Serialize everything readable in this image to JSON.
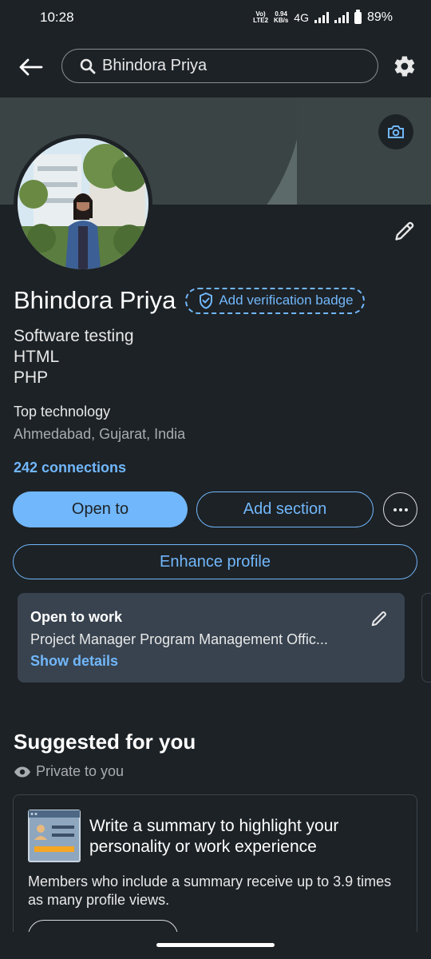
{
  "status_bar": {
    "time": "10:28",
    "volte": "Vo)) LTE2",
    "speed": "0.94 KB/s",
    "network": "4G",
    "battery": "89%"
  },
  "header": {
    "search_value": "Bhindora Priya",
    "icons": [
      "back-arrow-icon",
      "search-icon",
      "gear-icon",
      "camera-icon",
      "pencil-icon"
    ]
  },
  "profile": {
    "name": "Bhindora Priya",
    "verification_label": "Add verification badge",
    "headline": [
      "Software testing",
      "HTML",
      "PHP"
    ],
    "company": "Top technology",
    "location": "Ahmedabad, Gujarat, India",
    "connections": "242 connections"
  },
  "actions": {
    "open_to": "Open to",
    "add_section": "Add section",
    "enhance_profile": "Enhance profile"
  },
  "open_to_work": {
    "title": "Open to work",
    "roles": "Project Manager Program Management Offic...",
    "link": "Show details"
  },
  "suggested": {
    "title": "Suggested for you",
    "privacy": "Private to you",
    "card_title": "Write a summary to highlight your personality or work experience",
    "card_desc": "Members who include a summary receive up to 3.9 times as many profile views."
  },
  "colors": {
    "accent": "#71b7fb",
    "background": "#1d2226",
    "card": "#38434f"
  }
}
